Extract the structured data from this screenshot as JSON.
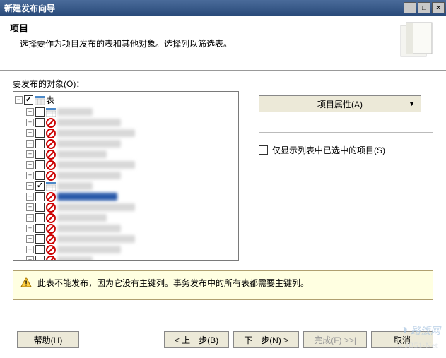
{
  "window": {
    "title": "新建发布向导"
  },
  "header": {
    "title": "项目",
    "subtitle": "选择要作为项目发布的表和其他对象。选择列以筛选表。"
  },
  "content": {
    "objects_label": "要发布的对象(O)：",
    "root_label": "表",
    "items": [
      {
        "checked": false,
        "blocked": false,
        "w": "w1"
      },
      {
        "checked": false,
        "blocked": true,
        "w": "w2"
      },
      {
        "checked": false,
        "blocked": true,
        "w": "w3"
      },
      {
        "checked": false,
        "blocked": true,
        "w": "w2"
      },
      {
        "checked": false,
        "blocked": true,
        "w": "w4"
      },
      {
        "checked": false,
        "blocked": true,
        "w": "w3"
      },
      {
        "checked": false,
        "blocked": true,
        "w": "w2"
      },
      {
        "checked": true,
        "blocked": false,
        "w": "w1"
      },
      {
        "checked": false,
        "blocked": true,
        "w": "sel"
      },
      {
        "checked": false,
        "blocked": true,
        "w": "w3"
      },
      {
        "checked": false,
        "blocked": true,
        "w": "w4"
      },
      {
        "checked": false,
        "blocked": true,
        "w": "w2"
      },
      {
        "checked": false,
        "blocked": true,
        "w": "w3"
      },
      {
        "checked": false,
        "blocked": true,
        "w": "w2"
      },
      {
        "checked": false,
        "blocked": true,
        "w": "w1"
      }
    ],
    "prop_button": "项目属性(A)",
    "show_selected_only": "仅显示列表中已选中的项目(S)",
    "show_selected_checked": false
  },
  "warning": {
    "text": "此表不能发布，因为它没有主键列。事务发布中的所有表都需要主键列。"
  },
  "footer": {
    "help": "帮助(H)",
    "back": "< 上一步(B)",
    "next": "下一步(N) >",
    "finish": "完成(F) >>|",
    "cancel": "取消"
  },
  "watermark": {
    "brand_cn": "路饭网",
    "brand_en": "4·JB51·Net"
  }
}
